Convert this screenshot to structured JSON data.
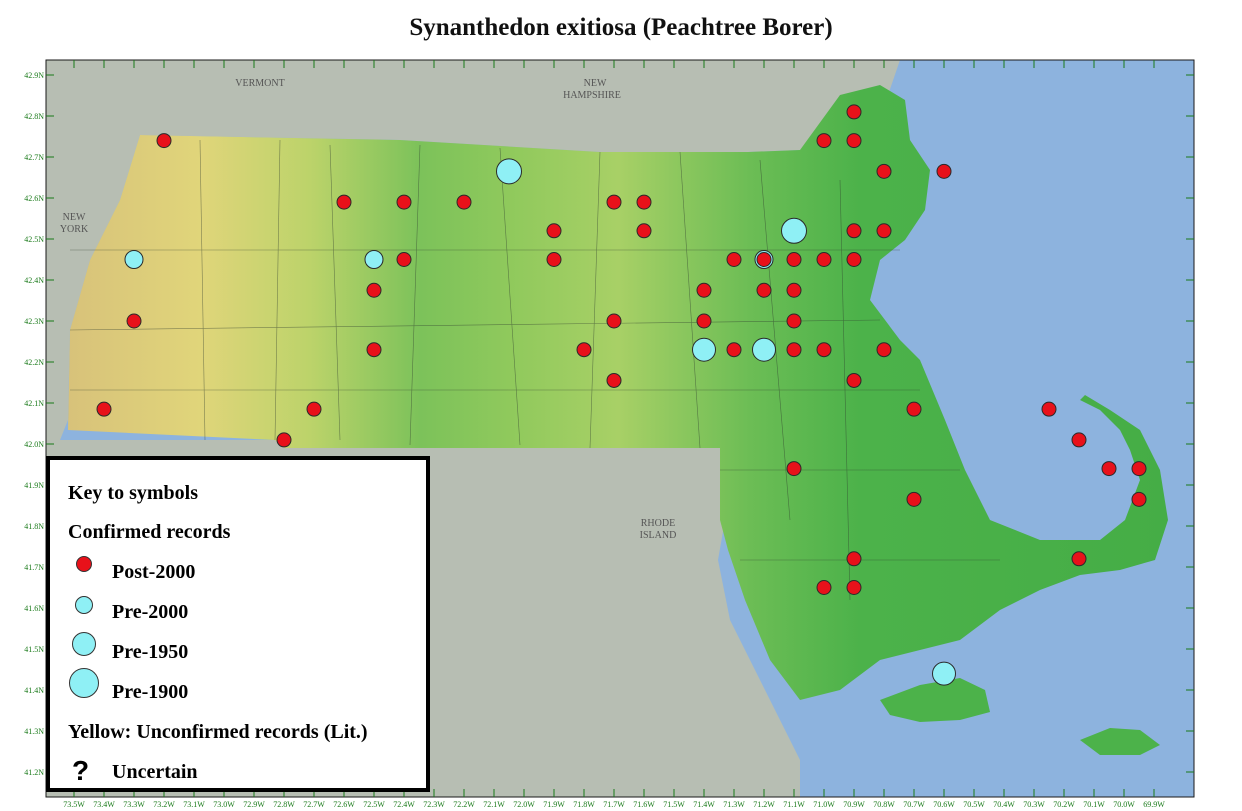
{
  "title": "Synanthedon exitiosa (Peachtree Borer)",
  "colors": {
    "ocean": "#8db3de",
    "neighbor_land": "#b7beb3",
    "land_green": "#4cb24a",
    "land_yellow": "#d9d77a",
    "post2000": "#e8111a",
    "pre_cyan": "#8ff0f5"
  },
  "map_labels": {
    "vermont": "VERMONT",
    "new_hampshire": [
      "NEW",
      "HAMPSHIRE"
    ],
    "new_york": [
      "NEW",
      "YORK"
    ],
    "rhode_island": [
      "RHODE",
      "ISLAND"
    ]
  },
  "lat_ticks": [
    "42.9N",
    "42.8N",
    "42.7N",
    "42.6N",
    "42.5N",
    "42.4N",
    "42.3N",
    "42.2N",
    "42.1N",
    "42.0N",
    "41.9N",
    "41.8N",
    "41.7N",
    "41.6N",
    "41.5N",
    "41.4N",
    "41.3N",
    "41.2N"
  ],
  "lon_ticks": [
    "73.5W",
    "73.4W",
    "73.3W",
    "73.2W",
    "73.1W",
    "73.0W",
    "72.9W",
    "72.8W",
    "72.7W",
    "72.6W",
    "72.5W",
    "72.4W",
    "72.3W",
    "72.2W",
    "72.1W",
    "72.0W",
    "71.9W",
    "71.8W",
    "71.7W",
    "71.6W",
    "71.5W",
    "71.4W",
    "71.3W",
    "71.2W",
    "71.1W",
    "71.0W",
    "70.9W",
    "70.8W",
    "70.7W",
    "70.6W",
    "70.5W",
    "70.4W",
    "70.3W",
    "70.2W",
    "70.1W",
    "70.0W",
    "69.9W"
  ],
  "legend": {
    "heading": "Key to symbols",
    "confirmed": "Confirmed records",
    "post2000": "Post-2000",
    "pre2000": "Pre-2000",
    "pre1950": "Pre-1950",
    "pre1900": "Pre-1900",
    "yellow_note": "Yellow: Unconfirmed records (Lit.)",
    "uncertain_symbol": "?",
    "uncertain": "Uncertain"
  },
  "records": [
    {
      "lon": -73.2,
      "lat": 42.74,
      "cat": "post2000"
    },
    {
      "lon": -72.6,
      "lat": 42.59,
      "cat": "post2000"
    },
    {
      "lon": -72.4,
      "lat": 42.59,
      "cat": "post2000"
    },
    {
      "lon": -72.2,
      "lat": 42.59,
      "cat": "post2000"
    },
    {
      "lon": -71.7,
      "lat": 42.59,
      "cat": "post2000"
    },
    {
      "lon": -71.6,
      "lat": 42.59,
      "cat": "post2000"
    },
    {
      "lon": -71.9,
      "lat": 42.52,
      "cat": "post2000"
    },
    {
      "lon": -71.6,
      "lat": 42.52,
      "cat": "post2000"
    },
    {
      "lon": -71.9,
      "lat": 42.45,
      "cat": "post2000"
    },
    {
      "lon": -72.4,
      "lat": 42.45,
      "cat": "post2000"
    },
    {
      "lon": -72.5,
      "lat": 42.375,
      "cat": "post2000"
    },
    {
      "lon": -73.3,
      "lat": 42.3,
      "cat": "post2000"
    },
    {
      "lon": -72.5,
      "lat": 42.23,
      "cat": "post2000"
    },
    {
      "lon": -73.4,
      "lat": 42.085,
      "cat": "post2000"
    },
    {
      "lon": -72.7,
      "lat": 42.085,
      "cat": "post2000"
    },
    {
      "lon": -72.8,
      "lat": 42.01,
      "cat": "post2000"
    },
    {
      "lon": -70.9,
      "lat": 42.81,
      "cat": "post2000"
    },
    {
      "lon": -71.0,
      "lat": 42.74,
      "cat": "post2000"
    },
    {
      "lon": -70.9,
      "lat": 42.74,
      "cat": "post2000"
    },
    {
      "lon": -70.8,
      "lat": 42.665,
      "cat": "post2000"
    },
    {
      "lon": -70.6,
      "lat": 42.665,
      "cat": "post2000"
    },
    {
      "lon": -70.9,
      "lat": 42.52,
      "cat": "post2000"
    },
    {
      "lon": -70.8,
      "lat": 42.52,
      "cat": "post2000"
    },
    {
      "lon": -71.3,
      "lat": 42.45,
      "cat": "post2000"
    },
    {
      "lon": -71.2,
      "lat": 42.45,
      "cat": "post2000"
    },
    {
      "lon": -71.1,
      "lat": 42.45,
      "cat": "post2000"
    },
    {
      "lon": -71.0,
      "lat": 42.45,
      "cat": "post2000"
    },
    {
      "lon": -70.9,
      "lat": 42.45,
      "cat": "post2000"
    },
    {
      "lon": -71.4,
      "lat": 42.375,
      "cat": "post2000"
    },
    {
      "lon": -71.2,
      "lat": 42.375,
      "cat": "post2000"
    },
    {
      "lon": -71.1,
      "lat": 42.375,
      "cat": "post2000"
    },
    {
      "lon": -71.4,
      "lat": 42.3,
      "cat": "post2000"
    },
    {
      "lon": -71.7,
      "lat": 42.3,
      "cat": "post2000"
    },
    {
      "lon": -71.1,
      "lat": 42.3,
      "cat": "post2000"
    },
    {
      "lon": -71.8,
      "lat": 42.23,
      "cat": "post2000"
    },
    {
      "lon": -71.3,
      "lat": 42.23,
      "cat": "post2000"
    },
    {
      "lon": -71.1,
      "lat": 42.23,
      "cat": "post2000"
    },
    {
      "lon": -71.0,
      "lat": 42.23,
      "cat": "post2000"
    },
    {
      "lon": -70.8,
      "lat": 42.23,
      "cat": "post2000"
    },
    {
      "lon": -71.7,
      "lat": 42.155,
      "cat": "post2000"
    },
    {
      "lon": -70.9,
      "lat": 42.155,
      "cat": "post2000"
    },
    {
      "lon": -70.7,
      "lat": 42.085,
      "cat": "post2000"
    },
    {
      "lon": -70.25,
      "lat": 42.085,
      "cat": "post2000"
    },
    {
      "lon": -70.15,
      "lat": 42.01,
      "cat": "post2000"
    },
    {
      "lon": -71.1,
      "lat": 41.94,
      "cat": "post2000"
    },
    {
      "lon": -70.05,
      "lat": 41.94,
      "cat": "post2000"
    },
    {
      "lon": -69.95,
      "lat": 41.94,
      "cat": "post2000"
    },
    {
      "lon": -70.7,
      "lat": 41.865,
      "cat": "post2000"
    },
    {
      "lon": -69.95,
      "lat": 41.865,
      "cat": "post2000"
    },
    {
      "lon": -70.9,
      "lat": 41.72,
      "cat": "post2000"
    },
    {
      "lon": -70.15,
      "lat": 41.72,
      "cat": "post2000"
    },
    {
      "lon": -71.0,
      "lat": 41.65,
      "cat": "post2000"
    },
    {
      "lon": -70.9,
      "lat": 41.65,
      "cat": "post2000"
    },
    {
      "lon": -73.3,
      "lat": 42.45,
      "cat": "pre2000"
    },
    {
      "lon": -72.5,
      "lat": 42.45,
      "cat": "pre2000"
    },
    {
      "lon": -71.2,
      "lat": 42.45,
      "cat": "pre2000"
    },
    {
      "lon": -71.4,
      "lat": 42.23,
      "cat": "pre1950"
    },
    {
      "lon": -71.2,
      "lat": 42.23,
      "cat": "pre1950"
    },
    {
      "lon": -70.6,
      "lat": 41.44,
      "cat": "pre1950"
    },
    {
      "lon": -72.05,
      "lat": 42.665,
      "cat": "pre1900"
    },
    {
      "lon": -71.1,
      "lat": 42.52,
      "cat": "pre1900"
    }
  ]
}
